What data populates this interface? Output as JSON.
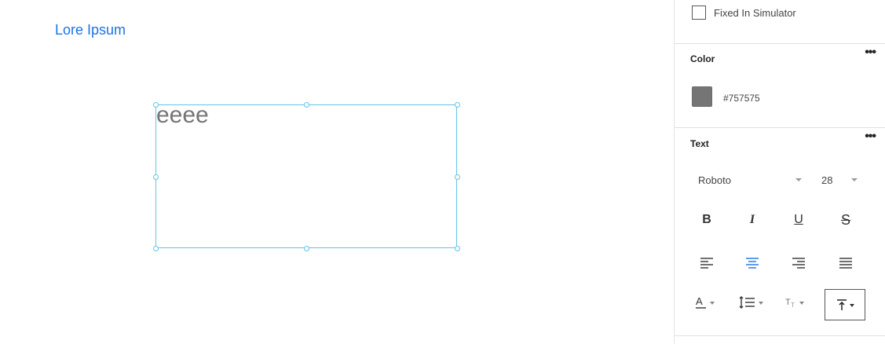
{
  "canvas": {
    "brand_text": "Lore Ipsum",
    "text_element": {
      "value": "eeee",
      "color": "#757575"
    },
    "selection_color": "#62c4e6"
  },
  "panel": {
    "fixed_checkbox": {
      "label": "Fixed In Simulator",
      "checked": false
    },
    "color_section": {
      "title": "Color",
      "more_label": "•••",
      "swatch_color": "#757575",
      "hex_value": "#757575"
    },
    "text_section": {
      "title": "Text",
      "more_label": "•••",
      "font_family": "Roboto",
      "font_size": "28",
      "style_buttons": [
        "B",
        "I",
        "U",
        "S"
      ],
      "alignment": {
        "selected": "center",
        "accent": "#1a73e8"
      },
      "tools": [
        "text-color-icon",
        "line-height-icon",
        "text-transform-icon",
        "vertical-align-top-icon"
      ]
    }
  }
}
